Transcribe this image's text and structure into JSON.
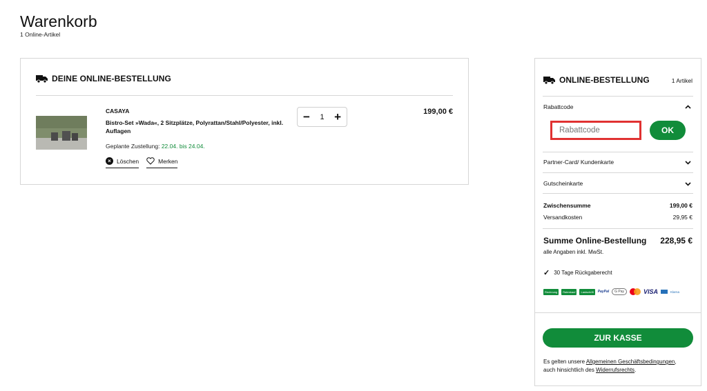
{
  "page": {
    "title": "Warenkorb",
    "subtitle": "1 Online-Artikel"
  },
  "order": {
    "heading": "DEINE ONLINE-BESTELLUNG",
    "item": {
      "brand": "CASAYA",
      "name": "Bistro-Set »Wada«, 2 Sitzplätze, Polyrattan/Stahl/Polyester, inkl. Auflagen",
      "delivery_label": "Geplante Zustellung:",
      "delivery_range": "22.04. bis 24.04.",
      "quantity": "1",
      "minus": "−",
      "plus": "+",
      "price": "199,00 €",
      "delete_label": "Löschen",
      "save_label": "Merken"
    }
  },
  "summary": {
    "heading": "ONLINE-BESTELLUNG",
    "count": "1 Artikel",
    "coupon_label": "Rabattcode",
    "coupon_placeholder": "Rabattcode",
    "ok_label": "OK",
    "partner_label": "Partner-Card/ Kundenkarte",
    "voucher_label": "Gutscheinkarte",
    "subtotal_label": "Zwischensumme",
    "subtotal_value": "199,00 €",
    "shipping_label": "Versandkosten",
    "shipping_value": "29,95 €",
    "total_label": "Summe Online-Bestellung",
    "total_value": "228,95 €",
    "vat_note": "alle Angaben inkl. MwSt.",
    "return_note": "30 Tage Rückgaberecht",
    "payments": {
      "rechnung": "Rechnung",
      "ratenkauf": "Ratenkauf",
      "lastschrift": "Lastschrift",
      "paypal": "PayPal",
      "gpay": "G Pay",
      "visa": "VISA",
      "klarna": "Klarna"
    },
    "checkout_label": "ZUR KASSE",
    "legal_prefix": "Es gelten unsere ",
    "legal_link1": "Allgemeinen Geschäftsbedingungen",
    "legal_mid": ",",
    "legal_line2": "auch hinsichtlich des ",
    "legal_link2": "Widerrufsrechts",
    "legal_end": "."
  },
  "colors": {
    "accent": "#118c3a",
    "highlight_border": "#e03131",
    "divider": "#d6d6d6"
  },
  "icons": [
    "truck-icon",
    "delete-icon",
    "heart-icon",
    "chevron-up-icon",
    "chevron-down-icon",
    "checkmark-icon"
  ]
}
